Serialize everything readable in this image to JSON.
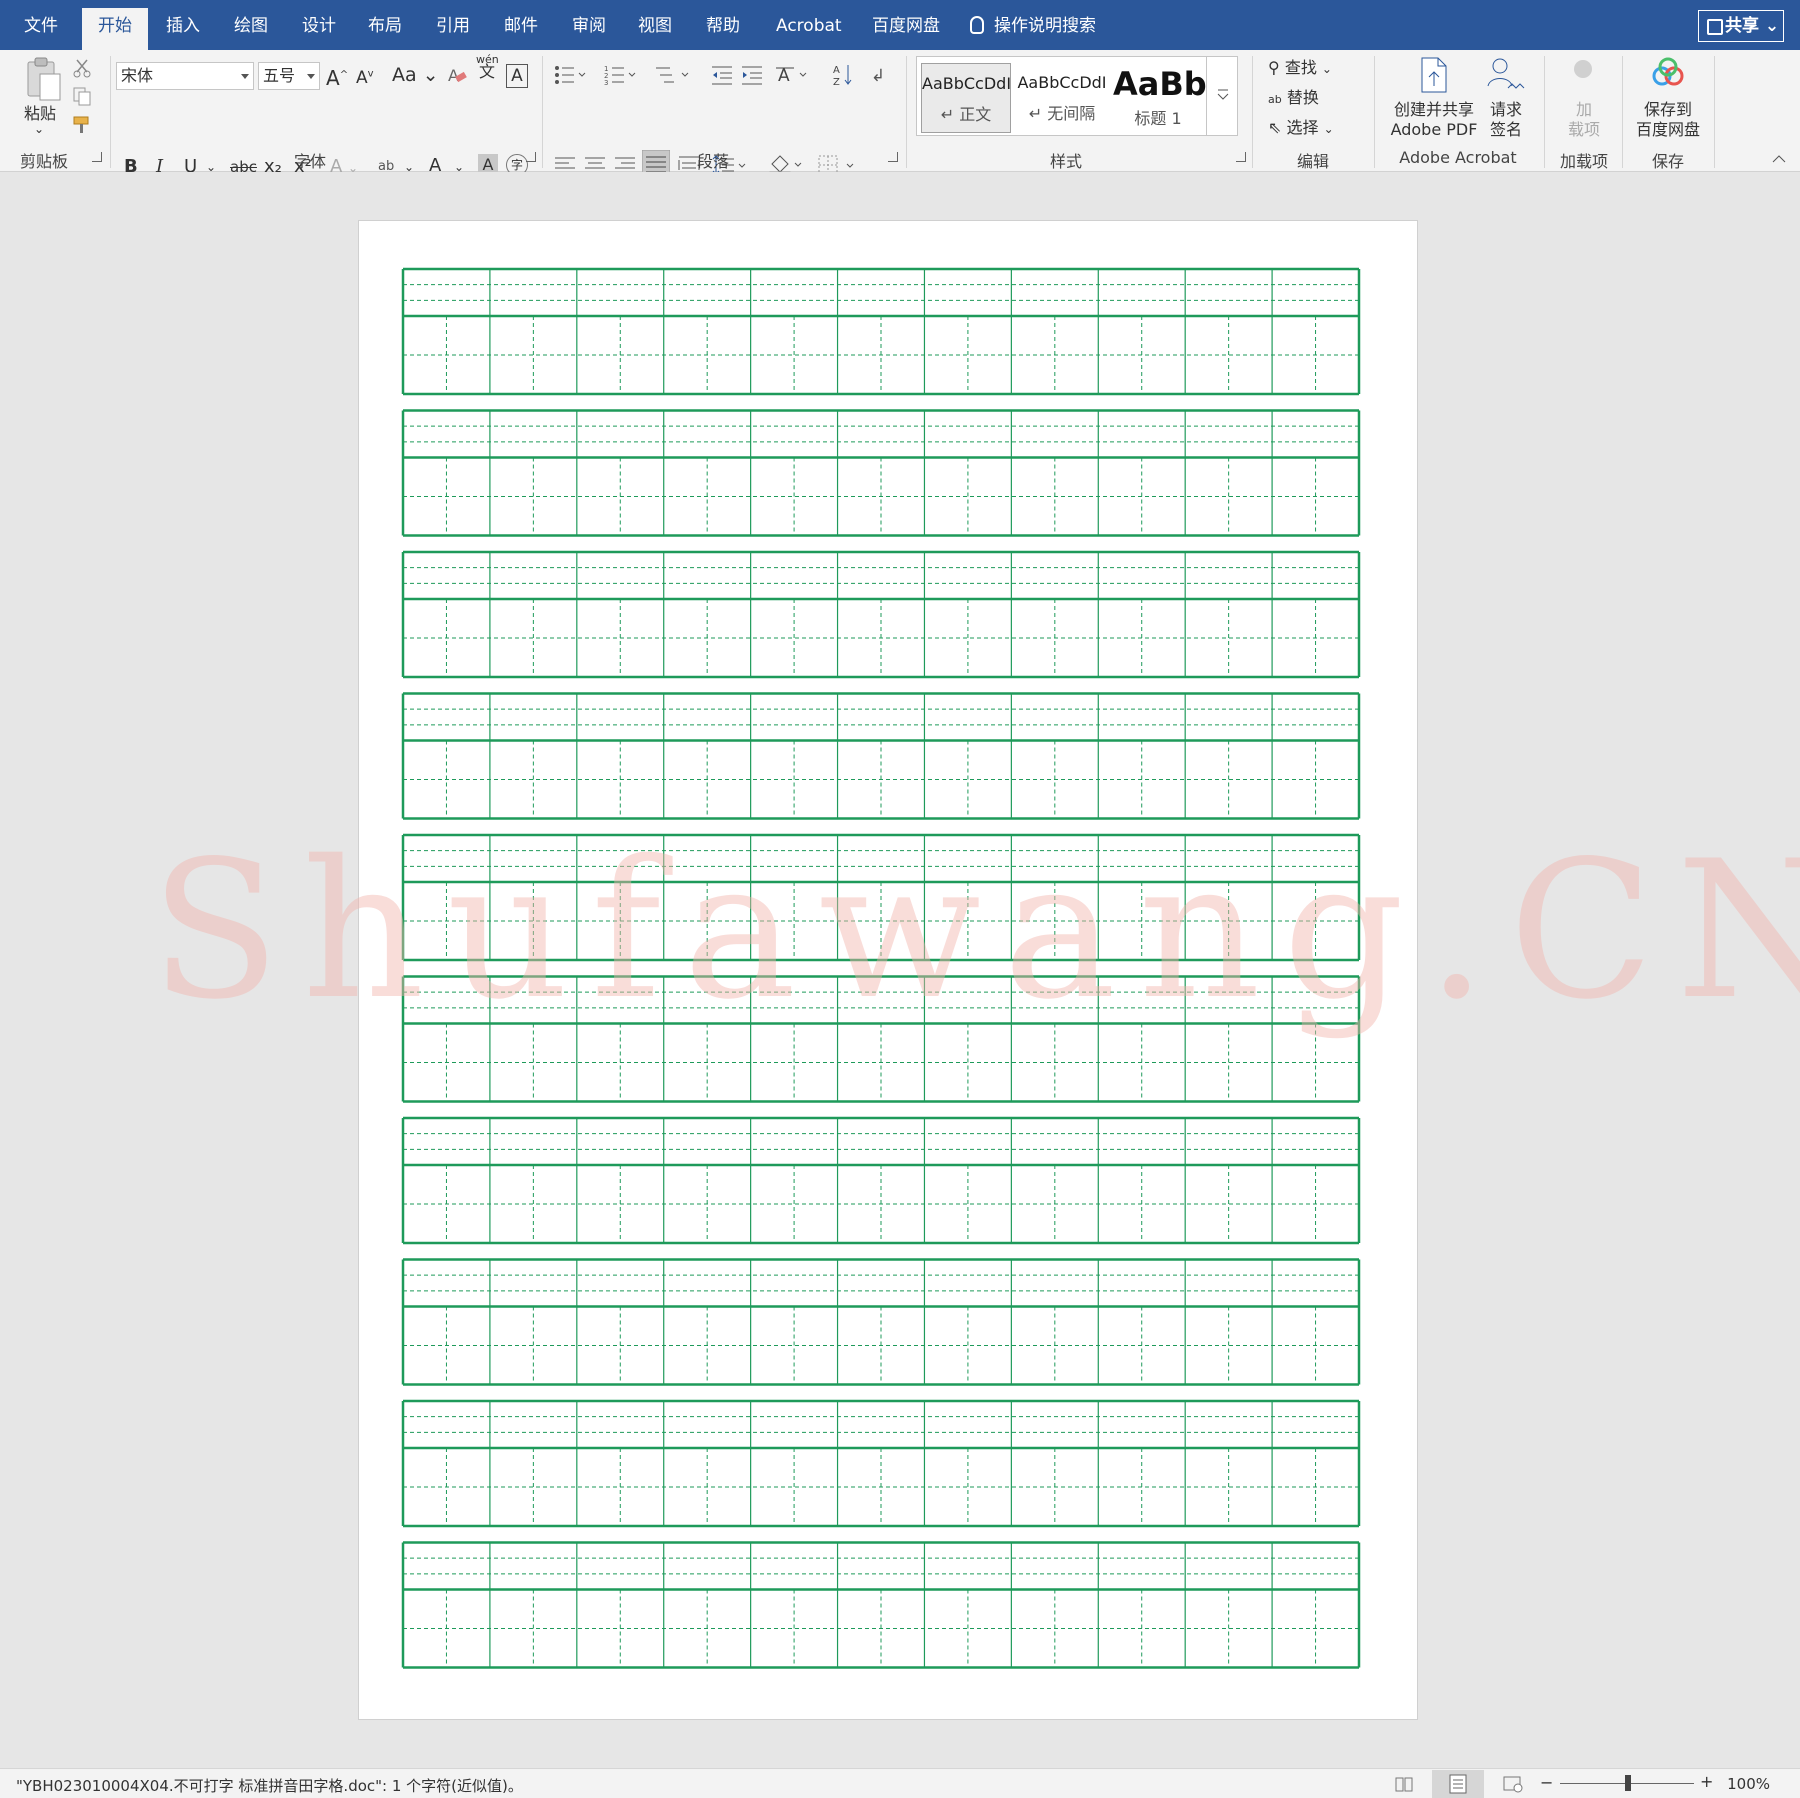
{
  "tabs": [
    {
      "label": "文件"
    },
    {
      "label": "开始"
    },
    {
      "label": "插入"
    },
    {
      "label": "绘图"
    },
    {
      "label": "设计"
    },
    {
      "label": "布局"
    },
    {
      "label": "引用"
    },
    {
      "label": "邮件"
    },
    {
      "label": "审阅"
    },
    {
      "label": "视图"
    },
    {
      "label": "帮助"
    },
    {
      "label": "Acrobat"
    },
    {
      "label": "百度网盘"
    }
  ],
  "active_tab": "开始",
  "tell_me": "操作说明搜索",
  "share_label": "共享",
  "ribbon": {
    "clipboard": {
      "paste_label": "粘贴",
      "group_label": "剪贴板"
    },
    "font": {
      "font_name": "宋体",
      "font_size": "五号",
      "case_label": "Aa",
      "group_label": "字体",
      "bold": "B",
      "italic": "I",
      "underline": "U",
      "strike": "abc",
      "sub": "x₂",
      "sup": "x²",
      "grow": "A",
      "shrink": "A",
      "phonetic": "文",
      "phonetic_top": "wén",
      "color_a": "A",
      "shade_a": "A",
      "enclose": "字"
    },
    "paragraph": {
      "group_label": "段落"
    },
    "styles": {
      "group_label": "样式",
      "items": [
        {
          "sample": "AaBbCcDdI",
          "name": "↵ 正文"
        },
        {
          "sample": "AaBbCcDdI",
          "name": "↵ 无间隔"
        },
        {
          "sample": "AaBb",
          "name": "标题 1"
        }
      ]
    },
    "editing": {
      "find": "查找",
      "replace": "替换",
      "select": "选择",
      "group_label": "编辑"
    },
    "acrobat": {
      "create_line1": "创建并共享",
      "create_line2": "Adobe PDF",
      "sign_line1": "请求",
      "sign_line2": "签名",
      "group_label": "Adobe Acrobat"
    },
    "addins": {
      "line1": "加",
      "line2": "载项",
      "group_label": "加载项"
    },
    "save": {
      "line1": "保存到",
      "line2": "百度网盘",
      "group_label": "保存"
    }
  },
  "document": {
    "watermark": "Shufawang.CN",
    "grid_color": "#1e9a5a",
    "rows": 10,
    "cols": 11
  },
  "status": {
    "text": "\"YBH023010004X04.不可打字 标准拼音田字格.doc\": 1 个字符(近似值)。",
    "zoom": "100%"
  },
  "colors": {
    "title_bar": "#2b579a",
    "ribbon_bg": "#f3f3f3",
    "highlight": "#ffff00",
    "font_color": "#e02020"
  }
}
